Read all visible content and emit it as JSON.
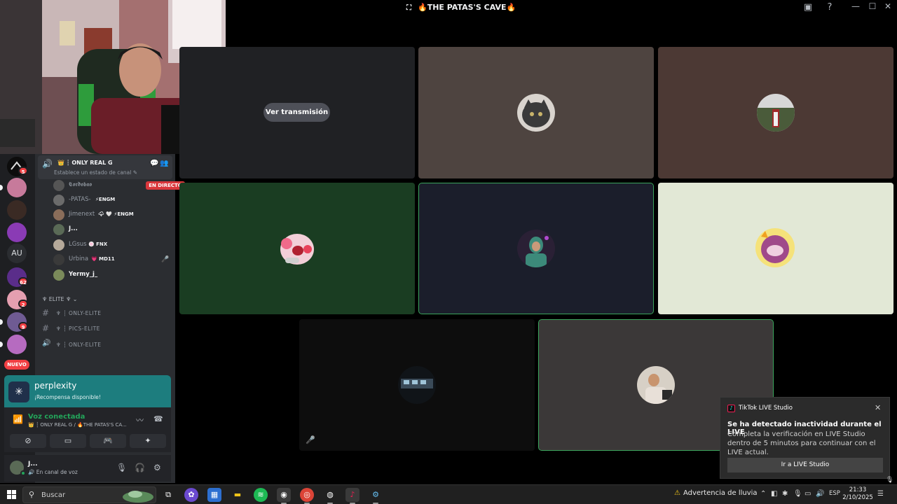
{
  "window": {
    "title": "🔥THE PATAS'S CAVE🔥",
    "minimize_glyph": "—",
    "maximize_glyph": "☐",
    "close_glyph": "✕"
  },
  "servers": {
    "badges": [
      "5",
      "62",
      "2",
      "9"
    ],
    "au_label": "AU",
    "new_label": "NUEVO"
  },
  "voice_channel": {
    "name": "👑 ┆ ONLY REAL G",
    "status_prompt": "Establece un estado de canal ✎",
    "members": [
      {
        "name": "𝕮𝖔𝖗𝖉𝖔𝖇𝖆𝖔",
        "tag": "",
        "live": "EN DIRECTO",
        "bright": false
      },
      {
        "name": "-PATAS-",
        "tag": "⚡ENGM",
        "live": "",
        "bright": false
      },
      {
        "name": "Jimenext",
        "tag": "🌩 🤍 ⚡ENGM",
        "live": "",
        "bright": false
      },
      {
        "name": "J...",
        "tag": "",
        "live": "",
        "bright": true
      },
      {
        "name": "LGsus",
        "tag": "🍥 FNX",
        "live": "",
        "bright": false
      },
      {
        "name": "Urbina",
        "tag": "💗 MD11",
        "live": "",
        "bright": false
      },
      {
        "name": "Yermy_j_",
        "tag": "",
        "live": "",
        "bright": true
      }
    ]
  },
  "category": {
    "name": "♆ ELITE ♆ ⌄",
    "channels": [
      {
        "type": "#",
        "name": "♆ ┆ ONLY-ELITE"
      },
      {
        "type": "#",
        "name": "♆ ┆ PICS-ELITE"
      },
      {
        "type": "🔊",
        "name": "♆ ┆ ONLY-ELITE"
      }
    ]
  },
  "promo": {
    "title": "perplexity",
    "subtitle": "¡Recompensa disponible!"
  },
  "voice_panel": {
    "title": "Voz conectada",
    "subtitle": "👑 ┆ ONLY REAL G / 🔥THE PATAS'S CA..."
  },
  "user": {
    "name": "J...",
    "status": "🔊 En canal de voz"
  },
  "stage": {
    "watch_button": "Ver transmisión"
  },
  "toast": {
    "app": "TikTok LIVE Studio",
    "title": "Se ha detectado inactividad durante el LIVE",
    "body": "Completa la verificación en LIVE Studio dentro de 5 minutos para continuar con el LIVE actual.",
    "button": "Ir a LIVE Studio",
    "close_glyph": "✕"
  },
  "taskbar": {
    "search_placeholder": "Buscar",
    "weather": "Advertencia de lluvia",
    "language": "ESP",
    "time": "21:33",
    "date": "2/10/2025"
  }
}
